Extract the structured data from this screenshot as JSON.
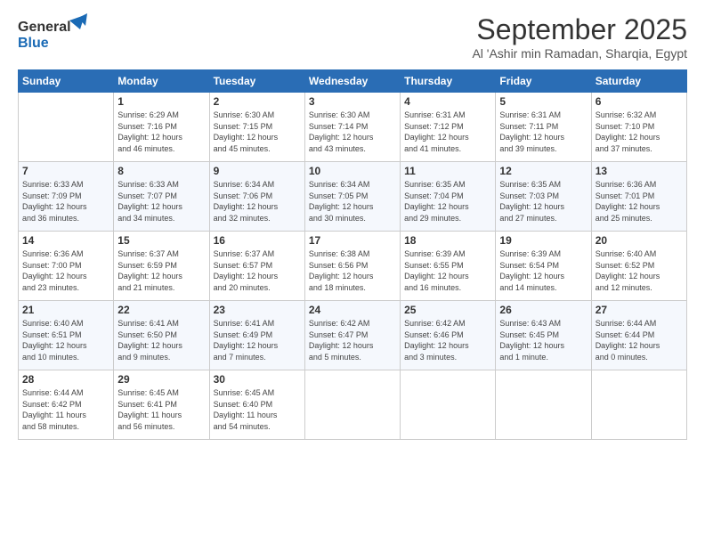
{
  "header": {
    "logo_line1": "General",
    "logo_line2": "Blue",
    "month": "September 2025",
    "location": "Al 'Ashir min Ramadan, Sharqia, Egypt"
  },
  "days_of_week": [
    "Sunday",
    "Monday",
    "Tuesday",
    "Wednesday",
    "Thursday",
    "Friday",
    "Saturday"
  ],
  "weeks": [
    [
      {
        "day": "",
        "info": ""
      },
      {
        "day": "1",
        "info": "Sunrise: 6:29 AM\nSunset: 7:16 PM\nDaylight: 12 hours\nand 46 minutes."
      },
      {
        "day": "2",
        "info": "Sunrise: 6:30 AM\nSunset: 7:15 PM\nDaylight: 12 hours\nand 45 minutes."
      },
      {
        "day": "3",
        "info": "Sunrise: 6:30 AM\nSunset: 7:14 PM\nDaylight: 12 hours\nand 43 minutes."
      },
      {
        "day": "4",
        "info": "Sunrise: 6:31 AM\nSunset: 7:12 PM\nDaylight: 12 hours\nand 41 minutes."
      },
      {
        "day": "5",
        "info": "Sunrise: 6:31 AM\nSunset: 7:11 PM\nDaylight: 12 hours\nand 39 minutes."
      },
      {
        "day": "6",
        "info": "Sunrise: 6:32 AM\nSunset: 7:10 PM\nDaylight: 12 hours\nand 37 minutes."
      }
    ],
    [
      {
        "day": "7",
        "info": "Sunrise: 6:33 AM\nSunset: 7:09 PM\nDaylight: 12 hours\nand 36 minutes."
      },
      {
        "day": "8",
        "info": "Sunrise: 6:33 AM\nSunset: 7:07 PM\nDaylight: 12 hours\nand 34 minutes."
      },
      {
        "day": "9",
        "info": "Sunrise: 6:34 AM\nSunset: 7:06 PM\nDaylight: 12 hours\nand 32 minutes."
      },
      {
        "day": "10",
        "info": "Sunrise: 6:34 AM\nSunset: 7:05 PM\nDaylight: 12 hours\nand 30 minutes."
      },
      {
        "day": "11",
        "info": "Sunrise: 6:35 AM\nSunset: 7:04 PM\nDaylight: 12 hours\nand 29 minutes."
      },
      {
        "day": "12",
        "info": "Sunrise: 6:35 AM\nSunset: 7:03 PM\nDaylight: 12 hours\nand 27 minutes."
      },
      {
        "day": "13",
        "info": "Sunrise: 6:36 AM\nSunset: 7:01 PM\nDaylight: 12 hours\nand 25 minutes."
      }
    ],
    [
      {
        "day": "14",
        "info": "Sunrise: 6:36 AM\nSunset: 7:00 PM\nDaylight: 12 hours\nand 23 minutes."
      },
      {
        "day": "15",
        "info": "Sunrise: 6:37 AM\nSunset: 6:59 PM\nDaylight: 12 hours\nand 21 minutes."
      },
      {
        "day": "16",
        "info": "Sunrise: 6:37 AM\nSunset: 6:57 PM\nDaylight: 12 hours\nand 20 minutes."
      },
      {
        "day": "17",
        "info": "Sunrise: 6:38 AM\nSunset: 6:56 PM\nDaylight: 12 hours\nand 18 minutes."
      },
      {
        "day": "18",
        "info": "Sunrise: 6:39 AM\nSunset: 6:55 PM\nDaylight: 12 hours\nand 16 minutes."
      },
      {
        "day": "19",
        "info": "Sunrise: 6:39 AM\nSunset: 6:54 PM\nDaylight: 12 hours\nand 14 minutes."
      },
      {
        "day": "20",
        "info": "Sunrise: 6:40 AM\nSunset: 6:52 PM\nDaylight: 12 hours\nand 12 minutes."
      }
    ],
    [
      {
        "day": "21",
        "info": "Sunrise: 6:40 AM\nSunset: 6:51 PM\nDaylight: 12 hours\nand 10 minutes."
      },
      {
        "day": "22",
        "info": "Sunrise: 6:41 AM\nSunset: 6:50 PM\nDaylight: 12 hours\nand 9 minutes."
      },
      {
        "day": "23",
        "info": "Sunrise: 6:41 AM\nSunset: 6:49 PM\nDaylight: 12 hours\nand 7 minutes."
      },
      {
        "day": "24",
        "info": "Sunrise: 6:42 AM\nSunset: 6:47 PM\nDaylight: 12 hours\nand 5 minutes."
      },
      {
        "day": "25",
        "info": "Sunrise: 6:42 AM\nSunset: 6:46 PM\nDaylight: 12 hours\nand 3 minutes."
      },
      {
        "day": "26",
        "info": "Sunrise: 6:43 AM\nSunset: 6:45 PM\nDaylight: 12 hours\nand 1 minute."
      },
      {
        "day": "27",
        "info": "Sunrise: 6:44 AM\nSunset: 6:44 PM\nDaylight: 12 hours\nand 0 minutes."
      }
    ],
    [
      {
        "day": "28",
        "info": "Sunrise: 6:44 AM\nSunset: 6:42 PM\nDaylight: 11 hours\nand 58 minutes."
      },
      {
        "day": "29",
        "info": "Sunrise: 6:45 AM\nSunset: 6:41 PM\nDaylight: 11 hours\nand 56 minutes."
      },
      {
        "day": "30",
        "info": "Sunrise: 6:45 AM\nSunset: 6:40 PM\nDaylight: 11 hours\nand 54 minutes."
      },
      {
        "day": "",
        "info": ""
      },
      {
        "day": "",
        "info": ""
      },
      {
        "day": "",
        "info": ""
      },
      {
        "day": "",
        "info": ""
      }
    ]
  ]
}
